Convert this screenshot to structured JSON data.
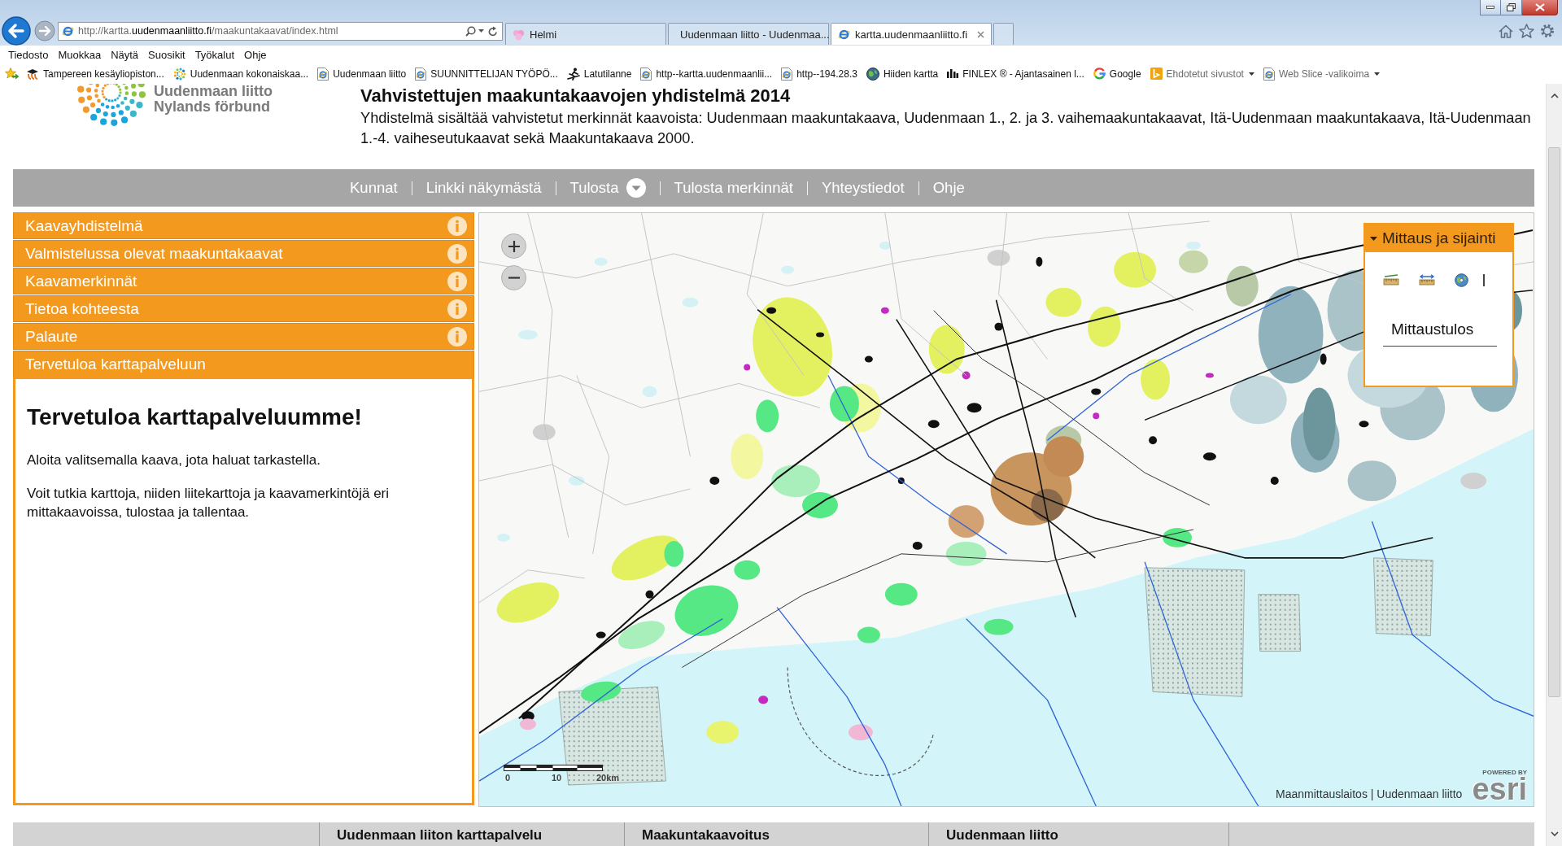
{
  "browser": {
    "address_bar": {
      "url": "http://kartta.**uudenmaanliitto.fi**/maakuntakaavat/index.html"
    },
    "tabs": [
      {
        "title": "Helmi",
        "selected": false
      },
      {
        "title": "Uudenmaan liitto - Uudenmaa...",
        "selected": false
      },
      {
        "title": "kartta.uudenmaanliitto.fi",
        "selected": true
      }
    ],
    "menu_bar": [
      "Tiedosto",
      "Muokkaa",
      "Näytä",
      "Suosikit",
      "Työkalut",
      "Ohje"
    ],
    "favorites_bar": [
      {
        "label": "Tampereen kesäyliopiston...",
        "dropdown": false
      },
      {
        "label": "Uudenmaan kokonaiskaa...",
        "dropdown": false
      },
      {
        "label": "Uudenmaan liitto",
        "dropdown": false
      },
      {
        "label": "SUUNNITTELIJAN TYÖPÖ...",
        "dropdown": false
      },
      {
        "label": "Latutilanne",
        "dropdown": false
      },
      {
        "label": "http--kartta.uudenmaanlii...",
        "dropdown": false
      },
      {
        "label": "http--194.28.3",
        "dropdown": false
      },
      {
        "label": "Hiiden kartta",
        "dropdown": false
      },
      {
        "label": "FINLEX ® - Ajantasainen l...",
        "dropdown": false
      },
      {
        "label": "Google",
        "dropdown": false
      },
      {
        "label": "Ehdotetut sivustot",
        "dropdown": true
      },
      {
        "label": "Web Slice -valikoima",
        "dropdown": true
      }
    ]
  },
  "header": {
    "logo": {
      "name": "Uudenmaan liitto",
      "subtitle": "Nylands förbund"
    },
    "title": "Vahvistettujen maakuntakaavojen yhdistelmä 2014",
    "description": "Yhdistelmä sisältää vahvistetut merkinnät kaavoista: Uudenmaan maakuntakaava, Uudenmaan 1., 2. ja 3. vaihemaakuntakaavat, Itä-Uudenmaan maakuntakaava, Itä-Uudenmaan 1.-4. vaiheseutukaavat sekä Maakuntakaava 2000."
  },
  "nav": [
    {
      "label": "Kunnat",
      "dropdown": false
    },
    {
      "label": "Linkki näkymästä",
      "dropdown": false
    },
    {
      "label": "Tulosta",
      "dropdown": true
    },
    {
      "label": "Tulosta merkinnät",
      "dropdown": false
    },
    {
      "label": "Yhteystiedot",
      "dropdown": false
    },
    {
      "label": "Ohje",
      "dropdown": false
    }
  ],
  "sidebar": {
    "sections": [
      {
        "title": "Kaavayhdistelmä",
        "expanded": false,
        "info": true
      },
      {
        "title": "Valmistelussa olevat maakuntakaavat",
        "expanded": false,
        "info": true
      },
      {
        "title": "Kaavamerkinnät",
        "expanded": false,
        "info": true
      },
      {
        "title": "Tietoa kohteesta",
        "expanded": false,
        "info": true
      },
      {
        "title": "Palaute",
        "expanded": false,
        "info": true
      },
      {
        "title": "Tervetuloa karttapalveluun",
        "expanded": true,
        "info": false,
        "body": {
          "heading": "Tervetuloa karttapalveluumme!",
          "paragraphs": [
            "Aloita valitsemalla kaava, jota haluat tarkastella.",
            "Voit tutkia karttoja, niiden liitekarttoja ja kaavamerkintöjä eri mittakaavoissa, tulostaa ja tallentaa."
          ]
        }
      }
    ]
  },
  "map": {
    "measure_widget": {
      "title": "Mittaus ja sijainti",
      "expanded": true,
      "result_label": "Mittaustulos"
    },
    "scale_bar": {
      "labels": [
        "0",
        "10",
        "20km"
      ]
    },
    "attribution": "Maanmittauslaitos | Uudenmaan liitto",
    "logo": {
      "tagline": "POWERED BY",
      "name": "esri"
    }
  },
  "footer": {
    "columns": [
      "Uudenmaan liiton karttapalvelu",
      "Maakuntakaavoitus",
      "Uudenmaan liitto"
    ]
  }
}
